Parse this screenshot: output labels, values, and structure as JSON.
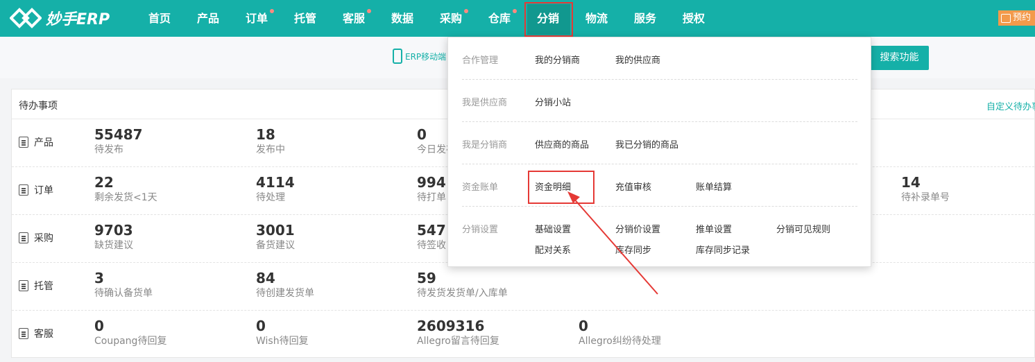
{
  "brand": {
    "name": "妙手ERP"
  },
  "nav": {
    "items": [
      {
        "label": "首页",
        "dot": false
      },
      {
        "label": "产品",
        "dot": false
      },
      {
        "label": "订单",
        "dot": true
      },
      {
        "label": "托管",
        "dot": false
      },
      {
        "label": "客服",
        "dot": true
      },
      {
        "label": "数据",
        "dot": false
      },
      {
        "label": "采购",
        "dot": true
      },
      {
        "label": "仓库",
        "dot": true
      },
      {
        "label": "分销",
        "dot": false,
        "active": true
      },
      {
        "label": "物流",
        "dot": false
      },
      {
        "label": "服务",
        "dot": false
      },
      {
        "label": "授权",
        "dot": false
      }
    ],
    "appointment_label": "预约"
  },
  "subbar": {
    "erp_mobile": "ERP移动端",
    "search_button": "搜索功能"
  },
  "panel": {
    "title": "待办事项",
    "custom_link": "自定义待办事",
    "rows": [
      {
        "label": "产品",
        "icon": "product-icon",
        "cells": [
          {
            "value": "55487",
            "label": "待发布"
          },
          {
            "value": "18",
            "label": "发布中"
          },
          {
            "value": "0",
            "label": "今日发布"
          }
        ]
      },
      {
        "label": "订单",
        "icon": "order-icon",
        "cells": [
          {
            "value": "22",
            "label": "剩余发货<1天"
          },
          {
            "value": "4114",
            "label": "待处理"
          },
          {
            "value": "994",
            "label": "待打单"
          },
          {
            "value": "14",
            "label": "待补录单号"
          }
        ]
      },
      {
        "label": "采购",
        "icon": "purchase-icon",
        "cells": [
          {
            "value": "9703",
            "label": "缺货建议"
          },
          {
            "value": "3001",
            "label": "备货建议"
          },
          {
            "value": "547",
            "label": "待签收"
          }
        ]
      },
      {
        "label": "托管",
        "icon": "hosting-icon",
        "cells": [
          {
            "value": "3",
            "label": "待确认备货单"
          },
          {
            "value": "84",
            "label": "待创建发货单"
          },
          {
            "value": "59",
            "label": "待发货发货单/入库单"
          }
        ]
      },
      {
        "label": "客服",
        "icon": "service-icon",
        "cells": [
          {
            "value": "0",
            "label": "Coupang待回复"
          },
          {
            "value": "0",
            "label": "Wish待回复"
          },
          {
            "value": "2609316",
            "label": "Allegro留言待回复"
          },
          {
            "value": "0",
            "label": "Allegro纠纷待处理"
          }
        ]
      }
    ]
  },
  "dropdown": {
    "sections": [
      {
        "title": "合作管理",
        "links": [
          "我的分销商",
          "我的供应商"
        ]
      },
      {
        "title": "我是供应商",
        "links": [
          "分销小站"
        ]
      },
      {
        "title": "我是分销商",
        "links": [
          "供应商的商品",
          "我已分销的商品"
        ]
      },
      {
        "title": "资金账单",
        "links": [
          "资金明细",
          "充值审核",
          "账单结算"
        ]
      },
      {
        "title": "分销设置",
        "links": [
          "基础设置",
          "分销价设置",
          "推单设置",
          "分销可见规则",
          "配对关系",
          "库存同步",
          "库存同步记录"
        ]
      }
    ]
  },
  "colors": {
    "brand": "#15b0a8",
    "highlight": "#e53935",
    "appointment": "#f39a4b"
  }
}
